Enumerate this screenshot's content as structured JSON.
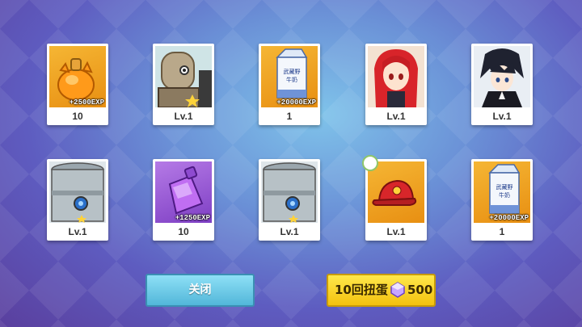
{
  "cards": [
    {
      "label": "10",
      "exp": "+2500EXP",
      "icon": "orange-exp-potion-icon"
    },
    {
      "label": "Lv.1",
      "exp": "",
      "icon": "robot-character-icon"
    },
    {
      "label": "1",
      "exp": "+20000EXP",
      "icon": "milk-carton-icon"
    },
    {
      "label": "Lv.1",
      "exp": "",
      "icon": "red-hair-girl-character-icon"
    },
    {
      "label": "Lv.1",
      "exp": "",
      "icon": "dark-hair-boy-character-icon"
    },
    {
      "label": "Lv.1",
      "exp": "",
      "icon": "metal-canister-icon"
    },
    {
      "label": "10",
      "exp": "+1250EXP",
      "icon": "purple-exp-potion-icon"
    },
    {
      "label": "Lv.1",
      "exp": "",
      "icon": "metal-canister-icon"
    },
    {
      "label": "Lv.1",
      "exp": "",
      "icon": "red-cap-icon"
    },
    {
      "label": "1",
      "exp": "+20000EXP",
      "icon": "milk-carton-icon"
    }
  ],
  "milk_text": "武藏野\n牛奶",
  "buttons": {
    "close_label": "关闭",
    "gacha_label": "10回扭蛋",
    "gacha_cost": "500",
    "gacha_currency_icon": "crystal-icon"
  },
  "colors": {
    "close_button": "#52b6d9",
    "gacha_button": "#f3c10f"
  }
}
